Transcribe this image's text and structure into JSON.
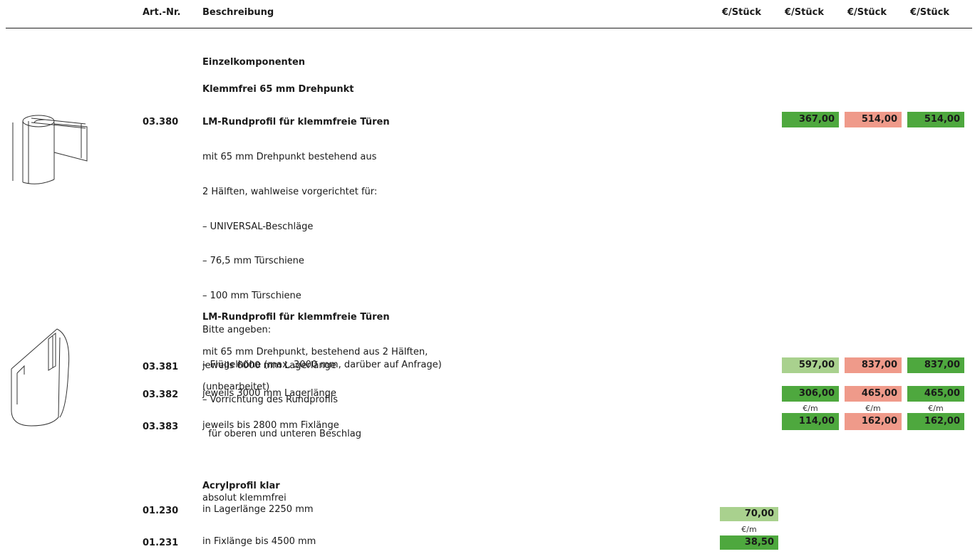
{
  "header": {
    "art_nr": "Art.-Nr.",
    "beschreibung": "Beschreibung",
    "col1": "€/Stück",
    "col2": "€/Stück",
    "col3": "€/Stück",
    "col4": "€/Stück"
  },
  "section_title": "Einzelkomponenten",
  "subsection_title": "Klemmfrei 65 mm Drehpunkt",
  "item1": {
    "art": "03.380",
    "title": "LM-Rundprofil für klemmfreie Türen",
    "lines": [
      "mit 65 mm Drehpunkt bestehend aus",
      "2 Hälften, wahlweise vorgerichtet für:",
      "– UNIVERSAL-Beschläge",
      "– 76,5 mm Türschiene",
      "– 100 mm Türschiene",
      "Bitte angeben:",
      "– Flügelhöhe (max. 3000 mm, darüber auf Anfrage)",
      "– Vorrichtung des Rundprofils",
      "  für oberen und unteren Beschlag"
    ],
    "prices": [
      "367,00",
      "514,00",
      "514,00"
    ]
  },
  "item2": {
    "title": "LM-Rundprofil für klemmfreie Türen",
    "lines": [
      "mit 65 mm Drehpunkt, bestehend aus 2 Hälften,",
      "(unbearbeitet)"
    ],
    "rows": [
      {
        "art": "03.381",
        "desc": "jeweils 6000 mm Lagerlänge",
        "prices": [
          "597,00",
          "837,00",
          "837,00"
        ]
      },
      {
        "art": "03.382",
        "desc": "jeweils 3000 mm Lagerlänge",
        "prices": [
          "306,00",
          "465,00",
          "465,00"
        ]
      },
      {
        "art": "03.383",
        "desc": "jeweils bis 2800 mm Fixlänge",
        "units": [
          "€/m",
          "€/m",
          "€/m"
        ],
        "prices": [
          "114,00",
          "162,00",
          "162,00"
        ]
      }
    ]
  },
  "item3": {
    "title": "Acrylprofil klar",
    "lines": [
      "absolut klemmfrei"
    ],
    "rows": [
      {
        "art": "01.230",
        "desc": "in Lagerlänge 2250 mm",
        "price": "70,00"
      },
      {
        "art": "01.231",
        "desc": "in Fixlänge bis 4500 mm",
        "unit": "€/m",
        "price": "38,50"
      }
    ]
  },
  "colors": {
    "green_dark": "#4ea83e",
    "green_light": "#a9d18e",
    "salmon": "#ef9a8a"
  }
}
